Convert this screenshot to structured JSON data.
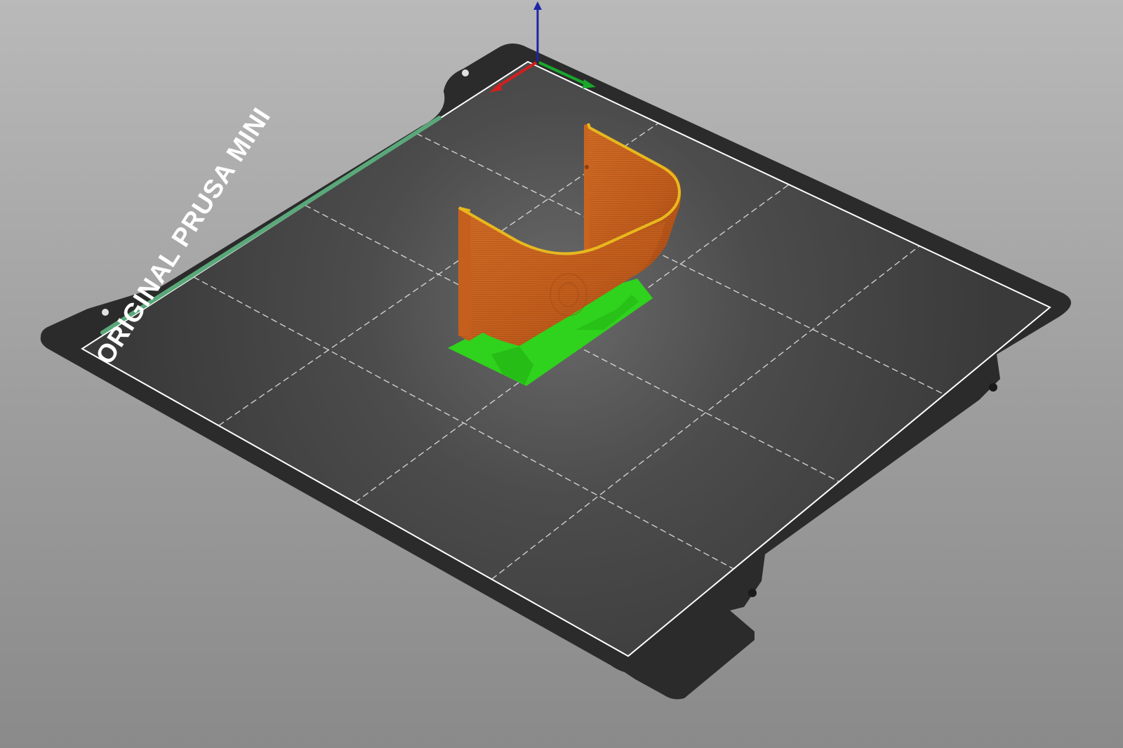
{
  "viewport": {
    "name": "3D print preview",
    "background_color": "#a8a8a8"
  },
  "bed": {
    "label": "ORIGINAL PRUSA MINI",
    "plate_color": "#2b2b2b",
    "surface_color": "#454545",
    "border_color": "#ffffff",
    "grid_color": "#e6e6e6",
    "grid_cells": 16
  },
  "axes": {
    "x_color": "#d21f1f",
    "y_color": "#18a82a",
    "z_color": "#1f25a8"
  },
  "model": {
    "body_color": "#c96420",
    "edge_color": "#e8b81e",
    "support_color": "#2fd21d"
  }
}
